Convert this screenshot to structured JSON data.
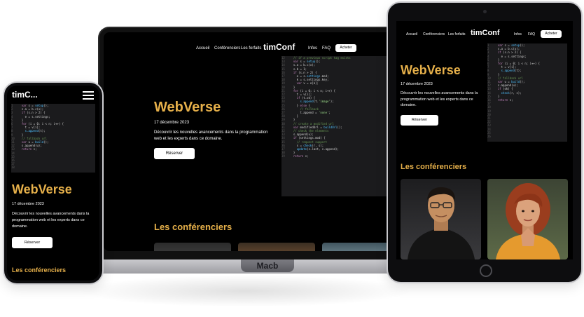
{
  "site": {
    "logo": "timConf",
    "logo_truncated": "timC...",
    "nav": [
      "Accueil",
      "Conférenciers",
      "Les forfaits",
      "Infos",
      "FAQ"
    ],
    "buy_button": "Acheter",
    "hero_title": "WebVerse",
    "hero_date": "17 décembre 2023",
    "hero_desc": "Découvrir les nouvelles avancements dans la programmation web et les experts dans ce domaine.",
    "reserve_button": "Réserver",
    "speakers_heading": "Les conférenciers"
  },
  "laptop": {
    "brand_label": "Macb"
  },
  "colors": {
    "gold": "#e6b04a",
    "background": "#000000",
    "white": "#ffffff"
  },
  "icons": {
    "menu": "hamburger-menu-icon"
  }
}
